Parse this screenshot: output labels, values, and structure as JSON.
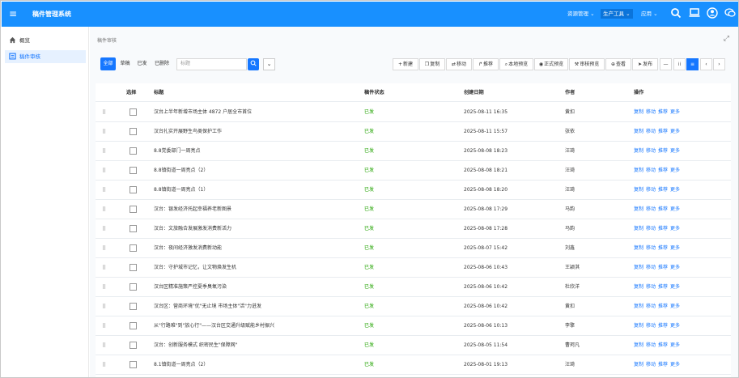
{
  "topbar": {
    "app_title": "稿件管理系统",
    "menu_resources": "资源管理",
    "menu_production": "生产工具",
    "menu_apps": "应用"
  },
  "sidebar": {
    "items": [
      {
        "label": "概览",
        "icon": "home-icon"
      },
      {
        "label": "稿件审核",
        "icon": "manuscript-icon"
      }
    ]
  },
  "content": {
    "breadcrumb": "稿件审核",
    "filters": [
      "全部",
      "草稿",
      "已发",
      "已删除"
    ],
    "search_placeholder": "标题",
    "toolbar": {
      "new": "新建",
      "copy": "复制",
      "move": "移动",
      "recommend": "推荐",
      "local_preview": "本地预览",
      "formal_preview": "正式预览",
      "audit_preview": "审核预览",
      "view": "查看",
      "publish": "发布"
    },
    "table": {
      "headers": [
        "选择",
        "标题",
        "稿件状态",
        "创建日期",
        "作者",
        "操作"
      ],
      "operations": [
        "复制",
        "移动",
        "推荐",
        "更多"
      ],
      "rows": [
        {
          "title": "汉台上半年新增市场主体 4872 户居全市首位",
          "status": "已发",
          "date": "2025-08-11 16:35",
          "author": "黄扣"
        },
        {
          "title": "汉台扎实开展野生鸟类保护工作",
          "status": "已发",
          "date": "2025-08-11 15:57",
          "author": "张依"
        },
        {
          "title": "8.8党委部门一周亮点",
          "status": "已发",
          "date": "2025-08-08 18:23",
          "author": "汪琦"
        },
        {
          "title": "8.8镇街道一周亮点（2）",
          "status": "已发",
          "date": "2025-08-08 18:21",
          "author": "汪琦"
        },
        {
          "title": "8.8镇街道一周亮点（1）",
          "status": "已发",
          "date": "2025-08-08 18:20",
          "author": "汪琦"
        },
        {
          "title": "汉台：银发经济托起幸福养老新图景",
          "status": "已发",
          "date": "2025-08-08 17:29",
          "author": "马韵"
        },
        {
          "title": "汉台：文旅融合发展激发消费新活力",
          "status": "已发",
          "date": "2025-08-08 17:28",
          "author": "马韵"
        },
        {
          "title": "汉台：夜间经济激发消费新动能",
          "status": "已发",
          "date": "2025-08-07 15:42",
          "author": "刘鑫"
        },
        {
          "title": "汉台：守护城市记忆，让文物焕发生机",
          "status": "已发",
          "date": "2025-08-06 10:43",
          "author": "王颖淇"
        },
        {
          "title": "汉台区精准施策严控夏季臭氧污染",
          "status": "已发",
          "date": "2025-08-06 10:42",
          "author": "杜欣洋"
        },
        {
          "title": "汉台区：营商环境\"优\"无止境 市场主体\"活\"力迸发",
          "status": "已发",
          "date": "2025-08-06 10:42",
          "author": "黄扣"
        },
        {
          "title": "从\"行路难\"到\"放心行\"——汉台区交通升级赋能乡村振兴",
          "status": "已发",
          "date": "2025-08-06 10:13",
          "author": "李擎"
        },
        {
          "title": "汉台：创新服务模式 织密民生\"保障网\"",
          "status": "已发",
          "date": "2025-08-05 11:54",
          "author": "曹珂凡"
        },
        {
          "title": "8.1镇街道一周亮点（2）",
          "status": "已发",
          "date": "2025-08-01 19:13",
          "author": "汪琦"
        }
      ]
    }
  },
  "colors": {
    "primary": "#1890ff",
    "status_published": "#21a300"
  }
}
